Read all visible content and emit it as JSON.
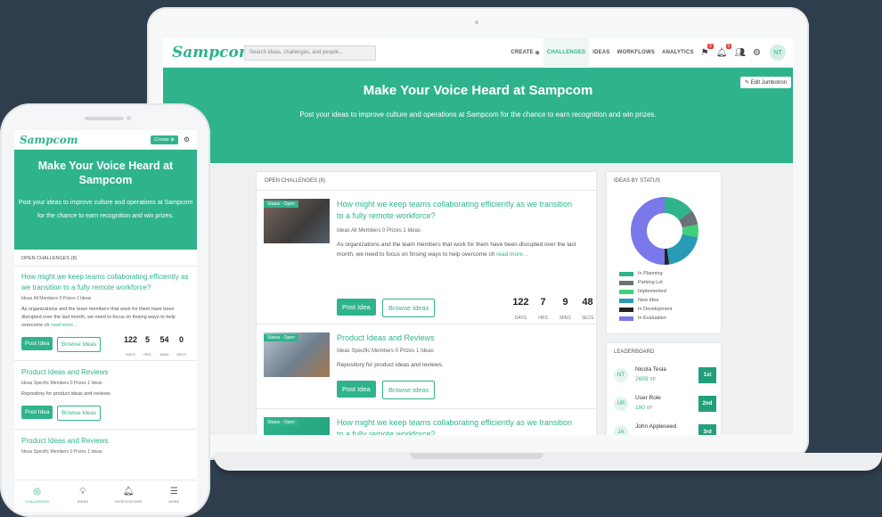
{
  "brand": {
    "logo": "Sampcom",
    "accent": "#2fb38c",
    "dark": "#22a07c"
  },
  "desktop": {
    "search_placeholder": "Search ideas, challenges, and people...",
    "nav": {
      "create": "CREATE",
      "challenges": "CHALLENGES",
      "ideas": "IDEAS",
      "workflows": "WORKFLOWS",
      "analytics": "ANALYTICS"
    },
    "badges": {
      "flags": "3",
      "notifications": "5"
    },
    "avatar": "NT",
    "jumbotron": {
      "title": "Make Your Voice Heard at Sampcom",
      "subtitle": "Post your ideas to improve culture and operations at Sampcom for the chance to earn recognition and win prizes.",
      "edit": "Edit Jumbotron"
    },
    "open_challenges": "OPEN CHALLENGES (8)",
    "challenges": [
      {
        "status": "Status - Open",
        "title": "How might we keep teams collaborating efficiently as we transition to a fully remote workforce?",
        "meta": "Ideas   All Members   0 Prizes   1 Ideas",
        "desc": "As organizations and the team members that work for them have been disrupted over the last month, we need to focus on finsing ways to help overcome ch",
        "more": "read more...",
        "post": "Post Idea",
        "browse": "Browse Ideas",
        "countdown": {
          "days": "122",
          "hrs": "7",
          "mins": "9",
          "secs": "48"
        }
      },
      {
        "status": "Status - Open",
        "title": "Product Ideas and Reviews",
        "meta": "Ideas   Specific Members   0 Prizes   1 Ideas",
        "desc": "Repository for product ideas and reviews.",
        "post": "Post Idea",
        "browse": "Browse Ideas"
      },
      {
        "status": "Status - Open",
        "title": "How might we keep teams collaborating efficiently as we transition to a fully remote workforce?"
      }
    ],
    "countdown_labels": {
      "days": "DAYS",
      "hrs": "HRS",
      "mins": "MINS",
      "secs": "SECS"
    },
    "ideas_by_status": {
      "title": "IDEAS BY STATUS",
      "legend": [
        {
          "label": "In Planning",
          "color": "#2fb38c"
        },
        {
          "label": "Parking Lot",
          "color": "#6b7178"
        },
        {
          "label": "Implemented",
          "color": "#3fd07a"
        },
        {
          "label": "New Idea",
          "color": "#2a9bb5"
        },
        {
          "label": "In Development",
          "color": "#222222"
        },
        {
          "label": "In Evaluation",
          "color": "#7b78ea"
        }
      ]
    },
    "leaderboard": {
      "title": "LEADERBOARD",
      "entries": [
        {
          "initials": "NT",
          "name": "Nicola Tesla",
          "xp": "2659",
          "rank": "1st"
        },
        {
          "initials": "UR",
          "name": "User Role",
          "xp": "180",
          "rank": "2nd"
        },
        {
          "initials": "JA",
          "name": "John Appleseed",
          "xp": "",
          "rank": "3rd"
        }
      ],
      "xp_unit": "XP"
    }
  },
  "mobile": {
    "create": "Create",
    "title": "Make Your Voice Heard at Sampcom",
    "subtitle": "Post your ideas to improve culture and operations at Sampcom for the chance to earn recognition and win prizes.",
    "open_challenges": "OPEN CHALLENGES (8)",
    "c1": {
      "title": "How might we keep teams collaborating efficiently as we transition to a fully remote workforce?",
      "meta": "Ideas   All Members   0 Prizes   1 Ideas",
      "desc": "As organizations and the team members that work for them have been disrupted over the last month, we need to focus on finsing ways to help overcome ch",
      "more": "read more...",
      "countdown": {
        "days": "122",
        "hrs": "5",
        "mins": "54",
        "secs": "0"
      }
    },
    "c2": {
      "title": "Product Ideas and Reviews",
      "meta": "Ideas   Specific Members   0 Prizes   1 Ideas",
      "desc": "Repository for product ideas and reviews."
    },
    "c3": {
      "title": "Product Ideas and Reviews",
      "meta": "Ideas   Specific Members   0 Prizes   1 Ideas"
    },
    "post": "Post Idea",
    "browse": "Browse Ideas",
    "tabs": {
      "challenges": "CHALLENGES",
      "ideas": "IDEAS",
      "notifications": "NOTIFICATIONS",
      "more": "MORE"
    }
  }
}
